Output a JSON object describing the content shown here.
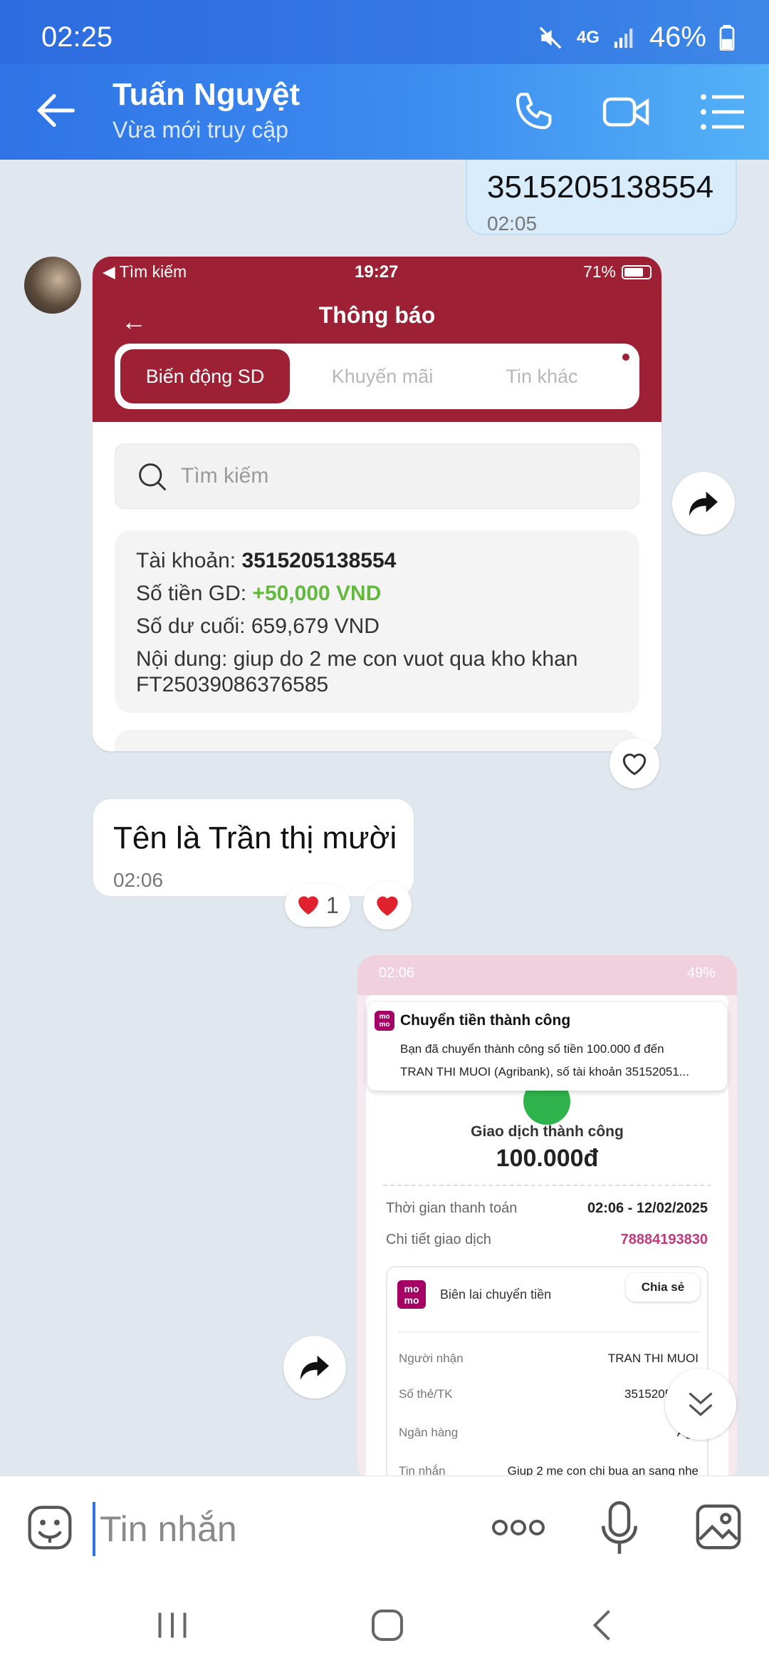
{
  "status_bar": {
    "time": "02:25",
    "network": "4G",
    "battery": "46%"
  },
  "header": {
    "contact_name": "Tuấn Nguyệt",
    "status": "Vừa mới truy cập"
  },
  "messages": {
    "out_1": {
      "text": "3515205138554",
      "time": "02:05"
    },
    "shot1": {
      "status_left": "◀ Tìm kiếm",
      "status_time": "19:27",
      "status_battery": "71%",
      "title": "Thông báo",
      "tabs": [
        "Biến động SD",
        "Khuyến mãi",
        "Tin khác"
      ],
      "search_placeholder": "Tìm kiếm",
      "account_label": "Tài khoản:",
      "account_value": "3515205138554",
      "amount_label": "Số tiền GD:",
      "amount_value": "+50,000 VND",
      "balance": "Số dư cuối: 659,679 VND",
      "content_1": "Nội dung: giup do 2 me con vuot qua kho khan",
      "content_2": "FT25039086376585"
    },
    "in_1": {
      "text": "Tên là Trần thị mười",
      "time": "02:06",
      "reaction_count": "1"
    },
    "shot2": {
      "status_time": "02:06",
      "status_battery": "49%",
      "logo": "mo mo",
      "notif_title": "Chuyển tiền thành công",
      "notif_line_1": "Bạn đã chuyển thành công số tiền 100.000 đ đến",
      "notif_line_2": "TRAN THI MUOI (Agribank), số tài khoản 35152051...",
      "result": "Giao dịch thành công",
      "amount": "100.000đ",
      "time_label": "Thời gian thanh toán",
      "time_value": "02:06 - 12/02/2025",
      "detail_label": "Chi tiết giao dịch",
      "detail_value": "78884193830",
      "receipt_title": "Biên lai chuyển tiền",
      "share": "Chia sẻ",
      "receiver_label": "Người nhận",
      "receiver_value": "TRAN THI MUOI",
      "account_label": "Số thẻ/TK",
      "account_value": "35152051385",
      "bank_label": "Ngân hàng",
      "bank_value": "Agri",
      "message_label": "Tin nhắn",
      "message_value": "Giup 2 me con chi bua an sang nhe"
    }
  },
  "input": {
    "placeholder": "Tin nhắn"
  },
  "colors": {
    "header": "#3d8cf0",
    "bank": "#9e2034",
    "momo": "#a50064"
  }
}
